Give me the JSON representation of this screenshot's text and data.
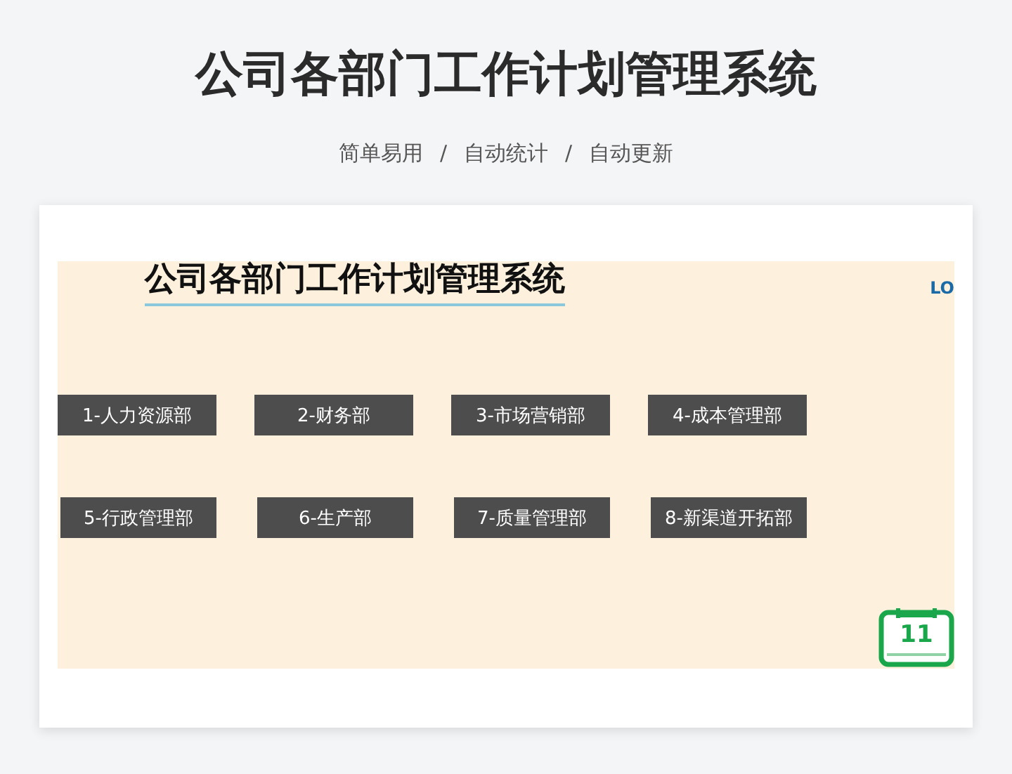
{
  "title": "公司各部门工作计划管理系统",
  "tagline": [
    "简单易用",
    "/",
    "自动统计",
    "/",
    "自动更新"
  ],
  "preview": {
    "title": "公司各部门工作计划管理系统",
    "logo_text": "LO",
    "departments": [
      {
        "label": "1-人力资源部"
      },
      {
        "label": "2-财务部"
      },
      {
        "label": "3-市场营销部"
      },
      {
        "label": "4-成本管理部"
      },
      {
        "label": "5-行政管理部"
      },
      {
        "label": "6-生产部"
      },
      {
        "label": "7-质量管理部"
      },
      {
        "label": "8-新渠道开拓部"
      }
    ],
    "calendar_day": "11"
  }
}
